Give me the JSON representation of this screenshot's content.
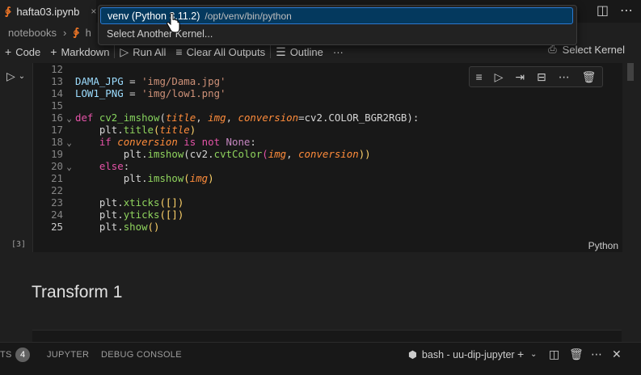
{
  "tab": {
    "title": "hafta03.ipynb",
    "close": "×"
  },
  "breadcrumb": {
    "folder": "notebooks",
    "separator": "›",
    "file": "h"
  },
  "toolbar": {
    "code_label": "Code",
    "markdown_label": "Markdown",
    "run_all_label": "Run All",
    "clear_outputs_label": "Clear All Outputs",
    "outline_label": "Outline",
    "more": "···",
    "select_kernel_label": "Select Kernel"
  },
  "kernel_picker": {
    "item1_label": "venv (Python 3.11.2)",
    "item1_path": "/opt/venv/bin/python",
    "item2_label": "Select Another Kernel..."
  },
  "cell": {
    "execution_count": "[3]",
    "language": "Python",
    "line_numbers": [
      "12",
      "13",
      "14",
      "15",
      "16",
      "17",
      "18",
      "19",
      "20",
      "21",
      "22",
      "23",
      "24",
      "25"
    ],
    "code": {
      "l13_name": "DAMA_JPG",
      "l13_eq": " = ",
      "l13_val": "'img/Dama.jpg'",
      "l14_name": "LOW1_PNG",
      "l14_eq": " = ",
      "l14_val": "'img/low1.png'",
      "l16_def": "def",
      "l16_fn": "cv2_imshow",
      "l16_open": "(",
      "l16_p1": "title",
      "l16_c1": ", ",
      "l16_p2": "img",
      "l16_c2": ", ",
      "l16_p3": "conversion",
      "l16_eq": "=",
      "l16_default": "cv2.COLOR_BGR2RGB",
      "l16_close": "):",
      "l17_obj": "plt.",
      "l17_fn": "title",
      "l17_open": "(",
      "l17_arg": "title",
      "l17_close": ")",
      "l18_if": "if",
      "l18_arg": "conversion",
      "l18_isnot": " is not ",
      "l18_none": "None",
      "l18_colon": ":",
      "l19_obj": "plt.",
      "l19_fn": "imshow",
      "l19_open": "(cv2.",
      "l19_fn2": "cvtColor",
      "l19_open2": "(",
      "l19_a1": "img",
      "l19_c": ", ",
      "l19_a2": "conversion",
      "l19_close": "))",
      "l20_else": "else",
      "l20_colon": ":",
      "l21_obj": "plt.",
      "l21_fn": "imshow",
      "l21_open": "(",
      "l21_arg": "img",
      "l21_close": ")",
      "l23_obj": "plt.",
      "l23_fn": "xticks",
      "l23_args": "([])",
      "l24_obj": "plt.",
      "l24_fn": "yticks",
      "l24_args": "([])",
      "l25_obj": "plt.",
      "l25_fn": "show",
      "l25_args": "()"
    }
  },
  "markdown": {
    "heading": "Transform 1"
  },
  "panel": {
    "tab_partial": "TS",
    "badge": "4",
    "jupyter": "JUPYTER",
    "debug_console": "DEBUG CONSOLE",
    "terminal_name": "bash - uu-dip-jupyter"
  }
}
